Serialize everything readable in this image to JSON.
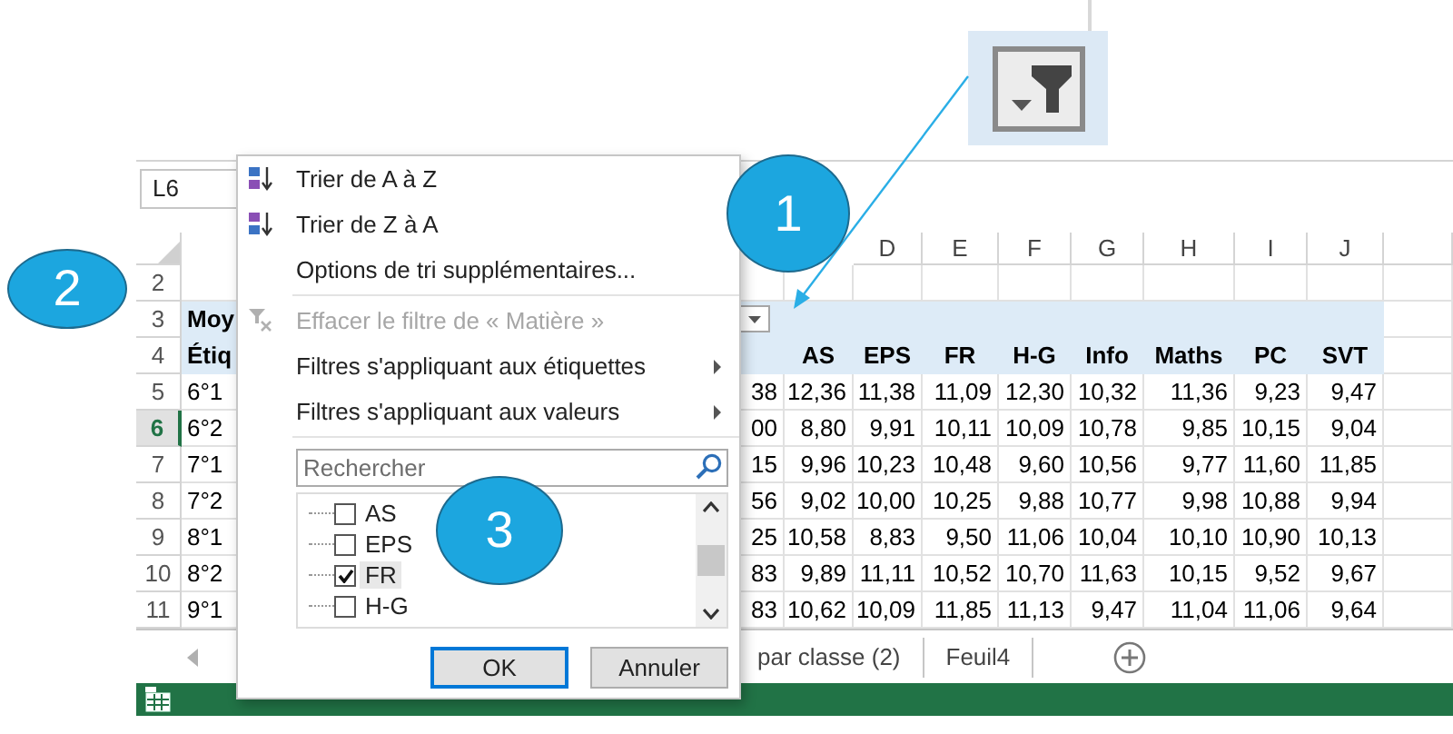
{
  "callouts": [
    {
      "label": "1"
    },
    {
      "label": "2"
    },
    {
      "label": "3"
    }
  ],
  "name_box": "L6",
  "column_letters": [
    "D",
    "E",
    "F",
    "G",
    "H",
    "I",
    "J"
  ],
  "rows": [
    {
      "number": "2",
      "kind": "blank",
      "selected": false
    },
    {
      "number": "3",
      "kind": "title",
      "selected": false,
      "label": "Moy",
      "filter_button": true
    },
    {
      "number": "4",
      "kind": "header",
      "selected": false,
      "label": "Étiq",
      "values": [
        "AS",
        "EPS",
        "FR",
        "H-G",
        "Info",
        "Maths",
        "PC",
        "SVT"
      ]
    },
    {
      "number": "5",
      "kind": "data",
      "selected": false,
      "label": "6°1",
      "col_b": "38",
      "values": [
        "12,36",
        "11,38",
        "11,09",
        "12,30",
        "10,32",
        "11,36",
        "9,23",
        "9,47"
      ]
    },
    {
      "number": "6",
      "kind": "data",
      "selected": true,
      "label": "6°2",
      "col_b": "00",
      "values": [
        "8,80",
        "9,91",
        "10,11",
        "10,09",
        "10,78",
        "9,85",
        "10,15",
        "9,04"
      ]
    },
    {
      "number": "7",
      "kind": "data",
      "selected": false,
      "label": "7°1",
      "col_b": "15",
      "values": [
        "9,96",
        "10,23",
        "10,48",
        "9,60",
        "10,56",
        "9,77",
        "11,60",
        "11,85"
      ]
    },
    {
      "number": "8",
      "kind": "data",
      "selected": false,
      "label": "7°2",
      "col_b": "56",
      "values": [
        "9,02",
        "10,00",
        "10,25",
        "9,88",
        "10,77",
        "9,98",
        "10,88",
        "9,94"
      ]
    },
    {
      "number": "9",
      "kind": "data",
      "selected": false,
      "label": "8°1",
      "col_b": "25",
      "values": [
        "10,58",
        "8,83",
        "9,50",
        "11,06",
        "10,04",
        "10,10",
        "10,90",
        "10,13"
      ]
    },
    {
      "number": "10",
      "kind": "data",
      "selected": false,
      "label": "8°2",
      "col_b": "83",
      "values": [
        "9,89",
        "11,11",
        "10,52",
        "10,70",
        "11,63",
        "10,15",
        "9,52",
        "9,67"
      ]
    },
    {
      "number": "11",
      "kind": "data",
      "selected": false,
      "label": "9°1",
      "col_b": "83",
      "values": [
        "10,62",
        "10,09",
        "11,85",
        "11,13",
        "9,47",
        "11,04",
        "11,06",
        "9,64"
      ]
    }
  ],
  "sheet_tabs": [
    {
      "label": "par classe (2)",
      "selected": false
    },
    {
      "label": "Feuil4",
      "selected": false
    }
  ],
  "filter_menu": {
    "items": [
      {
        "kind": "command",
        "label": "Trier de A à Z",
        "disabled": false,
        "submenu": false
      },
      {
        "kind": "command",
        "label": "Trier de Z à A",
        "disabled": false,
        "submenu": false
      },
      {
        "kind": "command",
        "label": "Options de tri supplémentaires...",
        "disabled": false,
        "submenu": false
      },
      {
        "kind": "separator"
      },
      {
        "kind": "command",
        "label": "Effacer le filtre de « Matière »",
        "disabled": true,
        "submenu": false
      },
      {
        "kind": "command",
        "label": "Filtres s'appliquant aux étiquettes",
        "disabled": false,
        "submenu": true
      },
      {
        "kind": "command",
        "label": "Filtres s'appliquant aux valeurs",
        "disabled": false,
        "submenu": true
      },
      {
        "kind": "separator"
      }
    ],
    "search": {
      "placeholder": "Rechercher"
    },
    "values": [
      {
        "label": "AS",
        "checked": false,
        "selected": false
      },
      {
        "label": "EPS",
        "checked": false,
        "selected": false
      },
      {
        "label": "FR",
        "checked": true,
        "selected": true
      },
      {
        "label": "H-G",
        "checked": false,
        "selected": false
      }
    ],
    "buttons": [
      {
        "label": "OK",
        "default": true
      },
      {
        "label": "Annuler",
        "default": false
      }
    ]
  }
}
